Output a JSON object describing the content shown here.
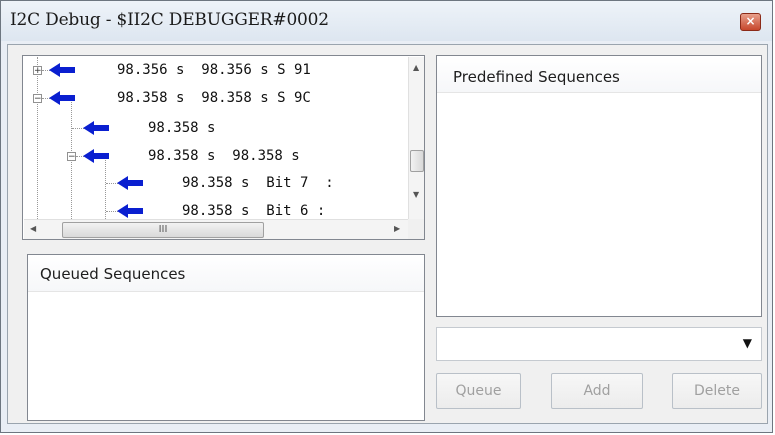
{
  "window": {
    "title": "I2C Debug - $II2C DEBUGGER#0002",
    "close_glyph": "×"
  },
  "tree": {
    "rows": [
      {
        "text": "98.356 s  98.356 s S 91",
        "expander": "+"
      },
      {
        "text": "98.358 s  98.358 s S 9C",
        "expander": "−"
      },
      {
        "text": "98.358 s",
        "expander": ""
      },
      {
        "text": "98.358 s  98.358 s",
        "expander": "−"
      },
      {
        "text": "98.358 s  Bit 7  :",
        "expander": ""
      },
      {
        "text": "98.358 s  Bit 6 :",
        "expander": ""
      }
    ],
    "hscroll_grip": "III",
    "arrow_color": "#0a1fd0"
  },
  "queued": {
    "header": "Queued Sequences"
  },
  "predefined": {
    "header": "Predefined Sequences"
  },
  "combo": {
    "value": "",
    "arrow": "▼"
  },
  "buttons": {
    "queue": "Queue",
    "add": "Add",
    "delete": "Delete"
  }
}
